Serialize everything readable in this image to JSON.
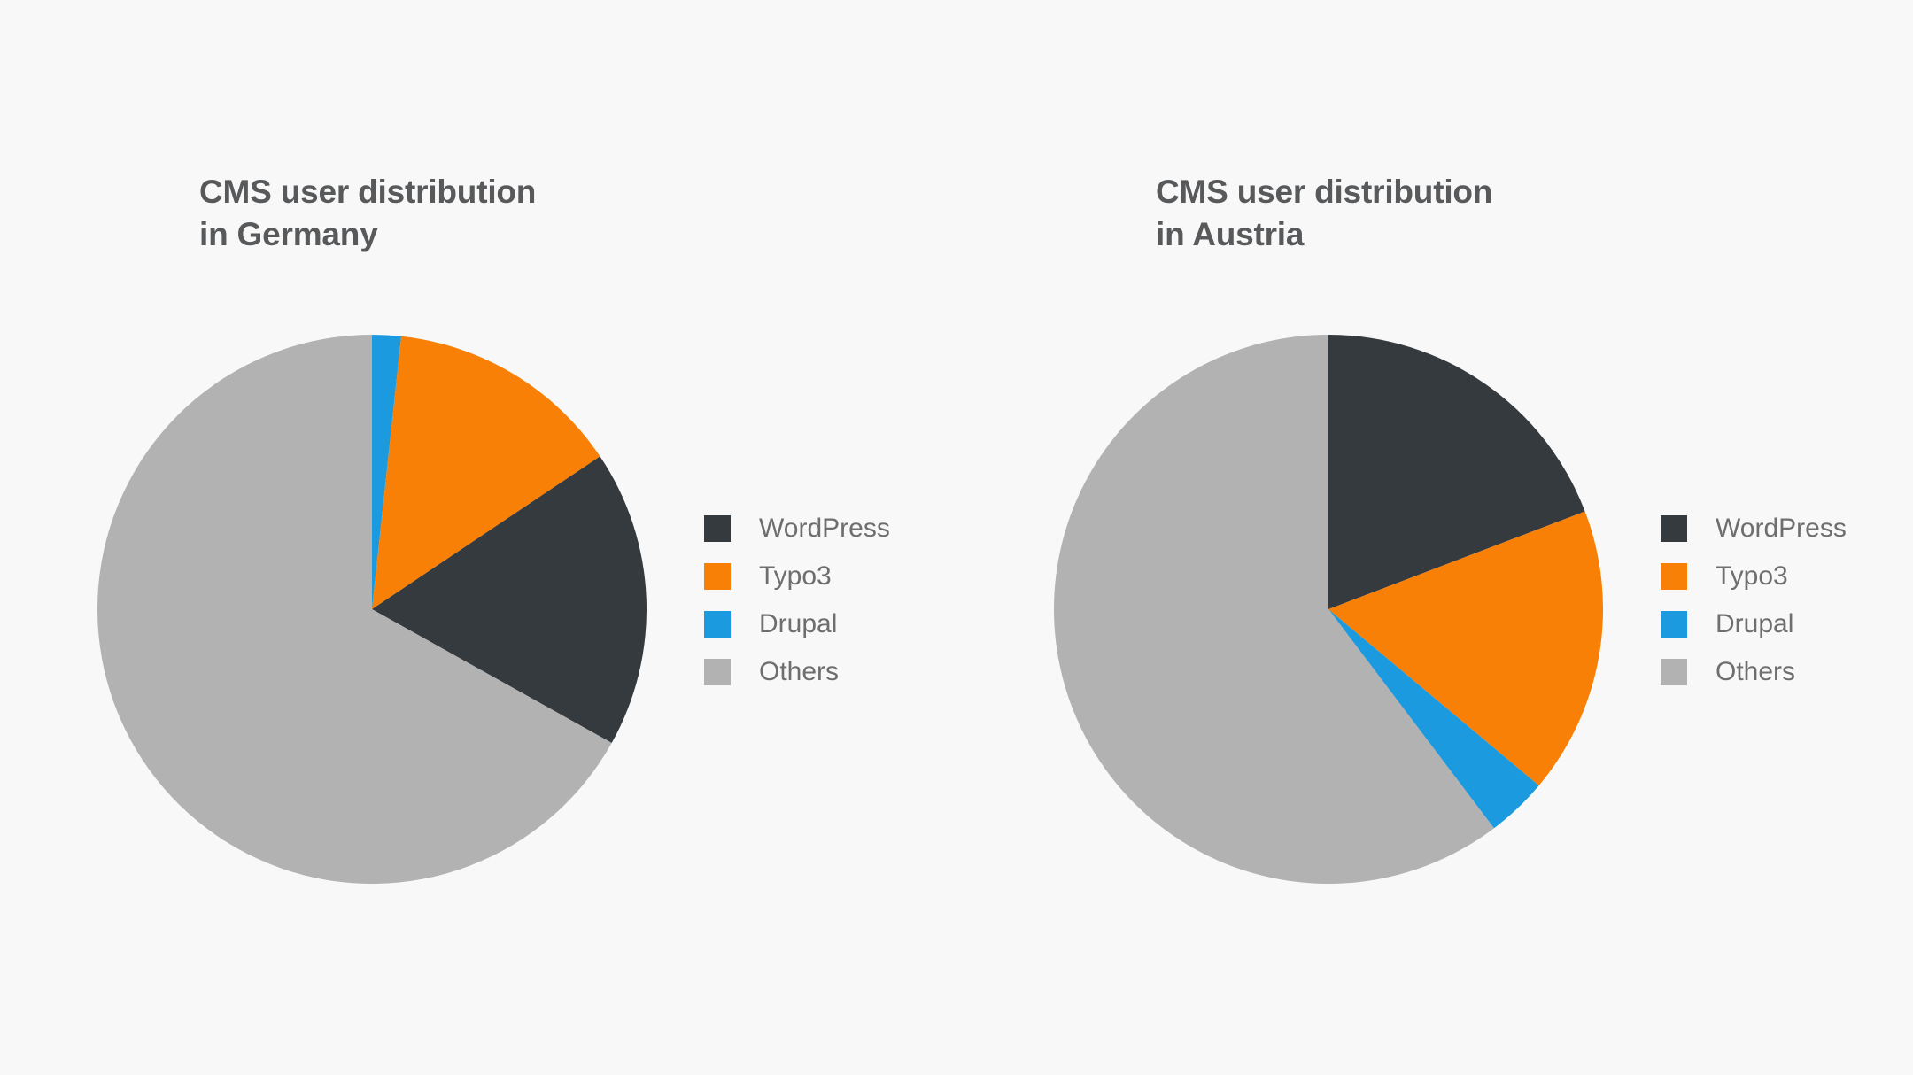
{
  "background_color": "#f8f8f8",
  "palette": {
    "wordpress": "#353a3e",
    "typo3": "#f98006",
    "drupal": "#1b9ae0",
    "others": "#b2b2b2",
    "title_text": "#58595b",
    "legend_text": "#6e6e70"
  },
  "charts": [
    {
      "id": "germany",
      "title": "CMS user distribution\nin Germany",
      "legend": [
        {
          "label": "WordPress",
          "color": "#353a3e"
        },
        {
          "label": "Typo3",
          "color": "#f98006"
        },
        {
          "label": "Drupal",
          "color": "#1b9ae0"
        },
        {
          "label": "Others",
          "color": "#b2b2b2"
        }
      ]
    },
    {
      "id": "austria",
      "title": "CMS user distribution\nin Austria",
      "legend": [
        {
          "label": "WordPress",
          "color": "#353a3e"
        },
        {
          "label": "Typo3",
          "color": "#f98006"
        },
        {
          "label": "Drupal",
          "color": "#1b9ae0"
        },
        {
          "label": "Others",
          "color": "#b2b2b2"
        }
      ]
    }
  ],
  "chart_data": [
    {
      "type": "pie",
      "title": "CMS user distribution in Germany",
      "labels": [
        "Drupal",
        "Typo3",
        "WordPress",
        "Others"
      ],
      "values": [
        1.7,
        13.9,
        17.5,
        66.9
      ],
      "colors": [
        "#1b9ae0",
        "#f98006",
        "#353a3e",
        "#b2b2b2"
      ],
      "start_angle_deg": 0,
      "direction": "clockwise",
      "legend_position": "right",
      "legend_order": [
        "WordPress",
        "Typo3",
        "Drupal",
        "Others"
      ],
      "data_labels": false
    },
    {
      "type": "pie",
      "title": "CMS user distribution in Austria",
      "labels": [
        "WordPress",
        "Typo3",
        "Drupal",
        "Others"
      ],
      "values": [
        19.2,
        16.9,
        3.6,
        60.3
      ],
      "colors": [
        "#353a3e",
        "#f98006",
        "#1b9ae0",
        "#b2b2b2"
      ],
      "start_angle_deg": 0,
      "direction": "clockwise",
      "legend_position": "right",
      "legend_order": [
        "WordPress",
        "Typo3",
        "Drupal",
        "Others"
      ],
      "data_labels": false
    }
  ]
}
